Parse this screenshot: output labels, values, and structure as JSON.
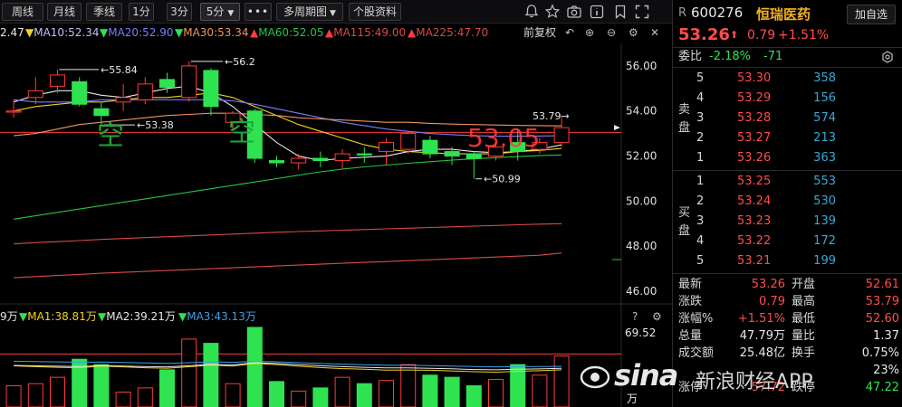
{
  "toolbar": {
    "period_tabs": [
      "周线",
      "月线",
      "季线",
      "1分",
      "3分"
    ],
    "period_dropdown": "5分",
    "more_label": "•••",
    "multi_period": "多周期图",
    "profile": "个股资料"
  },
  "chart_header": {
    "ma_leading": "2.47",
    "ma10": "MA10:52.34",
    "ma20": "MA20:52.90",
    "ma30": "MA30:53.34",
    "ma60": "MA60:52.05",
    "ma115": "MA115:49.00",
    "ma225": "MA225:47.70",
    "adjust": "前复权"
  },
  "colors": {
    "up": "#ff3b3b",
    "down": "#2ee34f",
    "ma5": "#e8e8e8",
    "ma10": "#f2d21b",
    "ma20": "#7a7cff",
    "ma30": "#f0955a",
    "ma60": "#22c646",
    "ma115": "#d84a4a",
    "ma225": "#d84a4a",
    "vol_ma1": "#f2d21b",
    "vol_ma2": "#e8e8e8",
    "vol_ma3": "#3fa0e8"
  },
  "price_axis": [
    "56.00",
    "54.00",
    "52.00",
    "50.00",
    "48.00",
    "46.00"
  ],
  "annotations": {
    "high1": "55.84",
    "high2": "56.2",
    "low1": "53.38",
    "low2": "50.99",
    "recent_high": "53.79",
    "watermark_price": "53.05",
    "short_mark1": "空",
    "short_mark2": "空"
  },
  "chart_data": {
    "type": "candlestick",
    "period": "5分",
    "ylim": [
      45.6,
      57.0
    ],
    "candles": [
      {
        "o": 53.95,
        "h": 54.5,
        "c": 54.0,
        "l": 53.7
      },
      {
        "o": 54.6,
        "h": 55.5,
        "c": 54.9,
        "l": 54.3
      },
      {
        "o": 55.1,
        "h": 55.84,
        "c": 55.6,
        "l": 54.8
      },
      {
        "o": 55.3,
        "h": 55.5,
        "c": 54.3,
        "l": 54.2
      },
      {
        "o": 54.1,
        "h": 54.4,
        "c": 53.8,
        "l": 53.38
      },
      {
        "o": 54.4,
        "h": 55.2,
        "c": 54.6,
        "l": 54.0
      },
      {
        "o": 54.5,
        "h": 55.5,
        "c": 55.2,
        "l": 54.3
      },
      {
        "o": 55.4,
        "h": 55.7,
        "c": 55.05,
        "l": 54.8
      },
      {
        "o": 54.6,
        "h": 56.2,
        "c": 56.0,
        "l": 54.4
      },
      {
        "o": 55.8,
        "h": 55.9,
        "c": 54.2,
        "l": 53.8
      },
      {
        "o": 53.5,
        "h": 54.0,
        "c": 53.9,
        "l": 53.2
      },
      {
        "o": 54.0,
        "h": 54.1,
        "c": 51.9,
        "l": 51.7
      },
      {
        "o": 51.8,
        "h": 52.0,
        "c": 51.7,
        "l": 51.5
      },
      {
        "o": 51.7,
        "h": 52.1,
        "c": 51.9,
        "l": 51.4
      },
      {
        "o": 51.9,
        "h": 52.2,
        "c": 51.8,
        "l": 51.5
      },
      {
        "o": 51.8,
        "h": 52.3,
        "c": 52.1,
        "l": 51.4
      },
      {
        "o": 52.1,
        "h": 52.4,
        "c": 52.05,
        "l": 51.7
      },
      {
        "o": 52.2,
        "h": 52.8,
        "c": 52.6,
        "l": 51.6
      },
      {
        "o": 52.3,
        "h": 53.1,
        "c": 53.0,
        "l": 52.1
      },
      {
        "o": 52.7,
        "h": 52.9,
        "c": 52.1,
        "l": 51.9
      },
      {
        "o": 52.2,
        "h": 52.4,
        "c": 52.0,
        "l": 51.6
      },
      {
        "o": 52.1,
        "h": 52.2,
        "c": 51.9,
        "l": 50.99
      },
      {
        "o": 52.0,
        "h": 52.6,
        "c": 52.4,
        "l": 51.8
      },
      {
        "o": 52.6,
        "h": 53.2,
        "c": 52.2,
        "l": 51.8
      },
      {
        "o": 52.3,
        "h": 52.8,
        "c": 52.6,
        "l": 52.1
      },
      {
        "o": 52.6,
        "h": 53.79,
        "c": 53.26,
        "l": 52.4
      }
    ],
    "ma": {
      "MA5": [
        54.4,
        54.7,
        54.9,
        54.9,
        54.7,
        54.6,
        54.8,
        55.0,
        55.1,
        54.8,
        54.2,
        53.4,
        52.6,
        52.0,
        51.8,
        51.9,
        51.95,
        52.0,
        52.2,
        52.3,
        52.3,
        52.2,
        52.15,
        52.2,
        52.3,
        52.5
      ],
      "MA10": [
        54.0,
        54.2,
        54.3,
        54.4,
        54.4,
        54.5,
        54.6,
        54.6,
        54.7,
        54.8,
        54.6,
        54.2,
        53.8,
        53.4,
        53.1,
        52.8,
        52.5,
        52.3,
        52.2,
        52.15,
        52.1,
        52.1,
        52.1,
        52.2,
        52.25,
        52.34
      ],
      "MA20": [
        54.5,
        54.4,
        54.4,
        54.4,
        54.5,
        54.5,
        54.5,
        54.5,
        54.5,
        54.5,
        54.45,
        54.3,
        54.1,
        53.9,
        53.7,
        53.5,
        53.35,
        53.2,
        53.1,
        53.0,
        52.95,
        52.9,
        52.88,
        52.88,
        52.89,
        52.9
      ],
      "MA30": [
        52.9,
        53.0,
        53.2,
        53.4,
        53.5,
        53.6,
        53.7,
        53.8,
        53.85,
        53.9,
        53.9,
        53.85,
        53.8,
        53.7,
        53.65,
        53.6,
        53.55,
        53.5,
        53.5,
        53.45,
        53.42,
        53.4,
        53.38,
        53.36,
        53.35,
        53.34
      ],
      "MA60": [
        49.2,
        49.35,
        49.5,
        49.65,
        49.8,
        49.95,
        50.1,
        50.25,
        50.4,
        50.55,
        50.7,
        50.85,
        51.0,
        51.15,
        51.3,
        51.42,
        51.52,
        51.6,
        51.68,
        51.75,
        51.82,
        51.88,
        51.93,
        51.98,
        52.02,
        52.05
      ],
      "MA115": [
        48.1,
        48.16,
        48.2,
        48.25,
        48.3,
        48.34,
        48.38,
        48.42,
        48.46,
        48.5,
        48.54,
        48.58,
        48.62,
        48.65,
        48.68,
        48.71,
        48.74,
        48.77,
        48.8,
        48.83,
        48.86,
        48.89,
        48.92,
        48.95,
        48.98,
        49.0
      ],
      "MA225": [
        46.6,
        46.65,
        46.7,
        46.75,
        46.8,
        46.84,
        46.88,
        46.92,
        46.96,
        47.0,
        47.04,
        47.08,
        47.12,
        47.16,
        47.2,
        47.24,
        47.28,
        47.32,
        47.36,
        47.4,
        47.44,
        47.48,
        47.52,
        47.56,
        47.6,
        47.7
      ]
    },
    "reference_line": 53.05,
    "volume_unit": "万",
    "volume_ylim": [
      0,
      75
    ],
    "volume": [
      20,
      22,
      28,
      45,
      40,
      14,
      18,
      35,
      64,
      60,
      22,
      75,
      24,
      15,
      18,
      28,
      22,
      25,
      40,
      30,
      28,
      20,
      26,
      40,
      30,
      48
    ],
    "volume_ma": {
      "MA1": [
        38.81,
        38.0,
        37.4,
        37.0,
        38.5,
        37.8,
        37.0,
        36.6,
        37.9,
        39.4,
        38.5,
        41.0,
        40.0,
        38.4,
        37.2,
        36.1,
        35.5,
        34.8,
        34.9,
        34.6,
        34.0,
        33.2,
        32.8,
        33.7,
        34.2,
        35.0
      ],
      "MA2": [
        39.21,
        38.8,
        38.4,
        38.2,
        39.0,
        38.5,
        38.0,
        37.8,
        38.9,
        40.2,
        39.6,
        41.8,
        41.0,
        39.9,
        38.9,
        38.0,
        37.4,
        36.9,
        36.8,
        36.5,
        36.0,
        35.3,
        35.0,
        35.6,
        35.9,
        36.4
      ],
      "MA3": [
        43.13,
        42.8,
        42.5,
        42.2,
        42.4,
        42.0,
        41.6,
        41.2,
        41.8,
        42.5,
        42.1,
        43.0,
        42.6,
        41.8,
        41.0,
        40.4,
        39.9,
        39.4,
        39.3,
        39.0,
        38.6,
        38.1,
        37.8,
        38.0,
        38.1,
        38.3
      ]
    }
  },
  "volume_panel": {
    "ma_leading": "9万",
    "ma1": "MA1:38.81万",
    "ma2": "MA2:39.21万",
    "ma3": "MA3:43.13万",
    "axis_top": "69.52",
    "axis_unit": "万"
  },
  "quote": {
    "badge": "R",
    "code": "600276",
    "name": "恒瑞医药",
    "add_watch": "加自选",
    "price": "53.26",
    "change": "0.79",
    "change_pct": "+1.51%",
    "wei_bi_label": "委比",
    "wei_bi_pct": "-2.18%",
    "wei_bi_diff": "-71",
    "sell_label": "卖盘",
    "buy_label": "买盘",
    "sell": [
      {
        "level": "5",
        "price": "53.30",
        "volume": "358"
      },
      {
        "level": "4",
        "price": "53.29",
        "volume": "156"
      },
      {
        "level": "3",
        "price": "53.28",
        "volume": "574"
      },
      {
        "level": "2",
        "price": "53.27",
        "volume": "213"
      },
      {
        "level": "1",
        "price": "53.26",
        "volume": "363"
      }
    ],
    "buy": [
      {
        "level": "1",
        "price": "53.25",
        "volume": "553"
      },
      {
        "level": "2",
        "price": "53.24",
        "volume": "530"
      },
      {
        "level": "3",
        "price": "53.23",
        "volume": "139"
      },
      {
        "level": "4",
        "price": "53.22",
        "volume": "172"
      },
      {
        "level": "5",
        "price": "53.21",
        "volume": "199"
      }
    ],
    "stats": [
      {
        "l1": "最新",
        "v1": "53.26",
        "c1": "red",
        "l2": "开盘",
        "v2": "52.61",
        "c2": "red"
      },
      {
        "l1": "涨跌",
        "v1": "0.79",
        "c1": "red",
        "l2": "最高",
        "v2": "53.79",
        "c2": "red"
      },
      {
        "l1": "涨幅%",
        "v1": "+1.51%",
        "c1": "red",
        "l2": "最低",
        "v2": "52.60",
        "c2": "red"
      },
      {
        "l1": "总量",
        "v1": "47.79万",
        "c1": "white",
        "l2": "量比",
        "v2": "1.37",
        "c2": "white"
      },
      {
        "l1": "成交额",
        "v1": "25.48亿",
        "c1": "white",
        "l2": "换手",
        "v2": "0.75%",
        "c2": "white"
      },
      {
        "l1": "",
        "v1": "",
        "c1": "white",
        "l2": "",
        "v2": "23%",
        "c2": "white"
      },
      {
        "l1": "涨停",
        "v1": "57.72",
        "c1": "red",
        "l2": "跌停",
        "v2": "47.22",
        "c2": "green"
      }
    ]
  },
  "watermark": {
    "brand": "sina",
    "text": "新浪财经APP"
  }
}
